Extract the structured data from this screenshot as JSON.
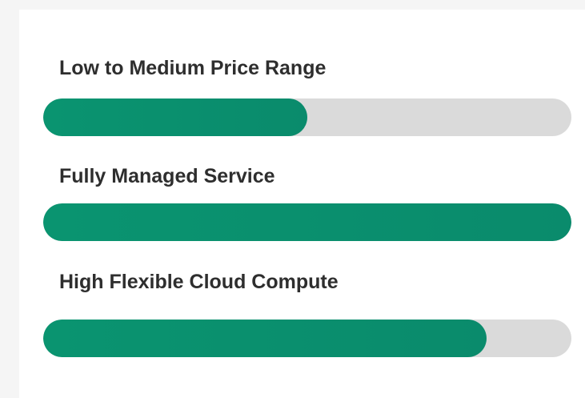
{
  "accent_color": "#0a8b6c",
  "track_color": "#dadada",
  "features": [
    {
      "label": "Low to Medium Price Range",
      "progress": 0.5
    },
    {
      "label": "Fully Managed Service",
      "progress": 1.0
    },
    {
      "label": "High Flexible Cloud Compute",
      "progress": 0.84
    }
  ]
}
